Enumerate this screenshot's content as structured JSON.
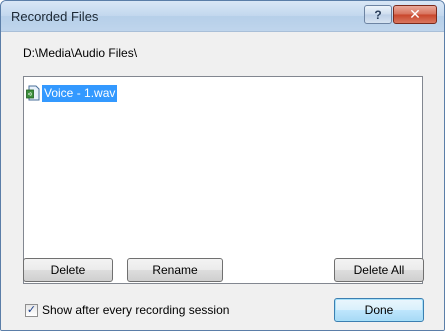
{
  "window": {
    "title": "Recorded Files",
    "help_label": "?",
    "close_label": "✕"
  },
  "path": "D:\\Media\\Audio Files\\",
  "files": [
    {
      "name": "Voice - 1.wav",
      "selected": true,
      "icon": "audio-file-icon"
    }
  ],
  "buttons": {
    "delete": "Delete",
    "rename": "Rename",
    "delete_all": "Delete All",
    "done": "Done"
  },
  "show_after_session": {
    "label": "Show after every recording session",
    "checked": true,
    "check_glyph": "✓"
  },
  "colors": {
    "selection": "#3399ff",
    "titlebar": "#c2d7ee",
    "close_button": "#c8452b"
  }
}
